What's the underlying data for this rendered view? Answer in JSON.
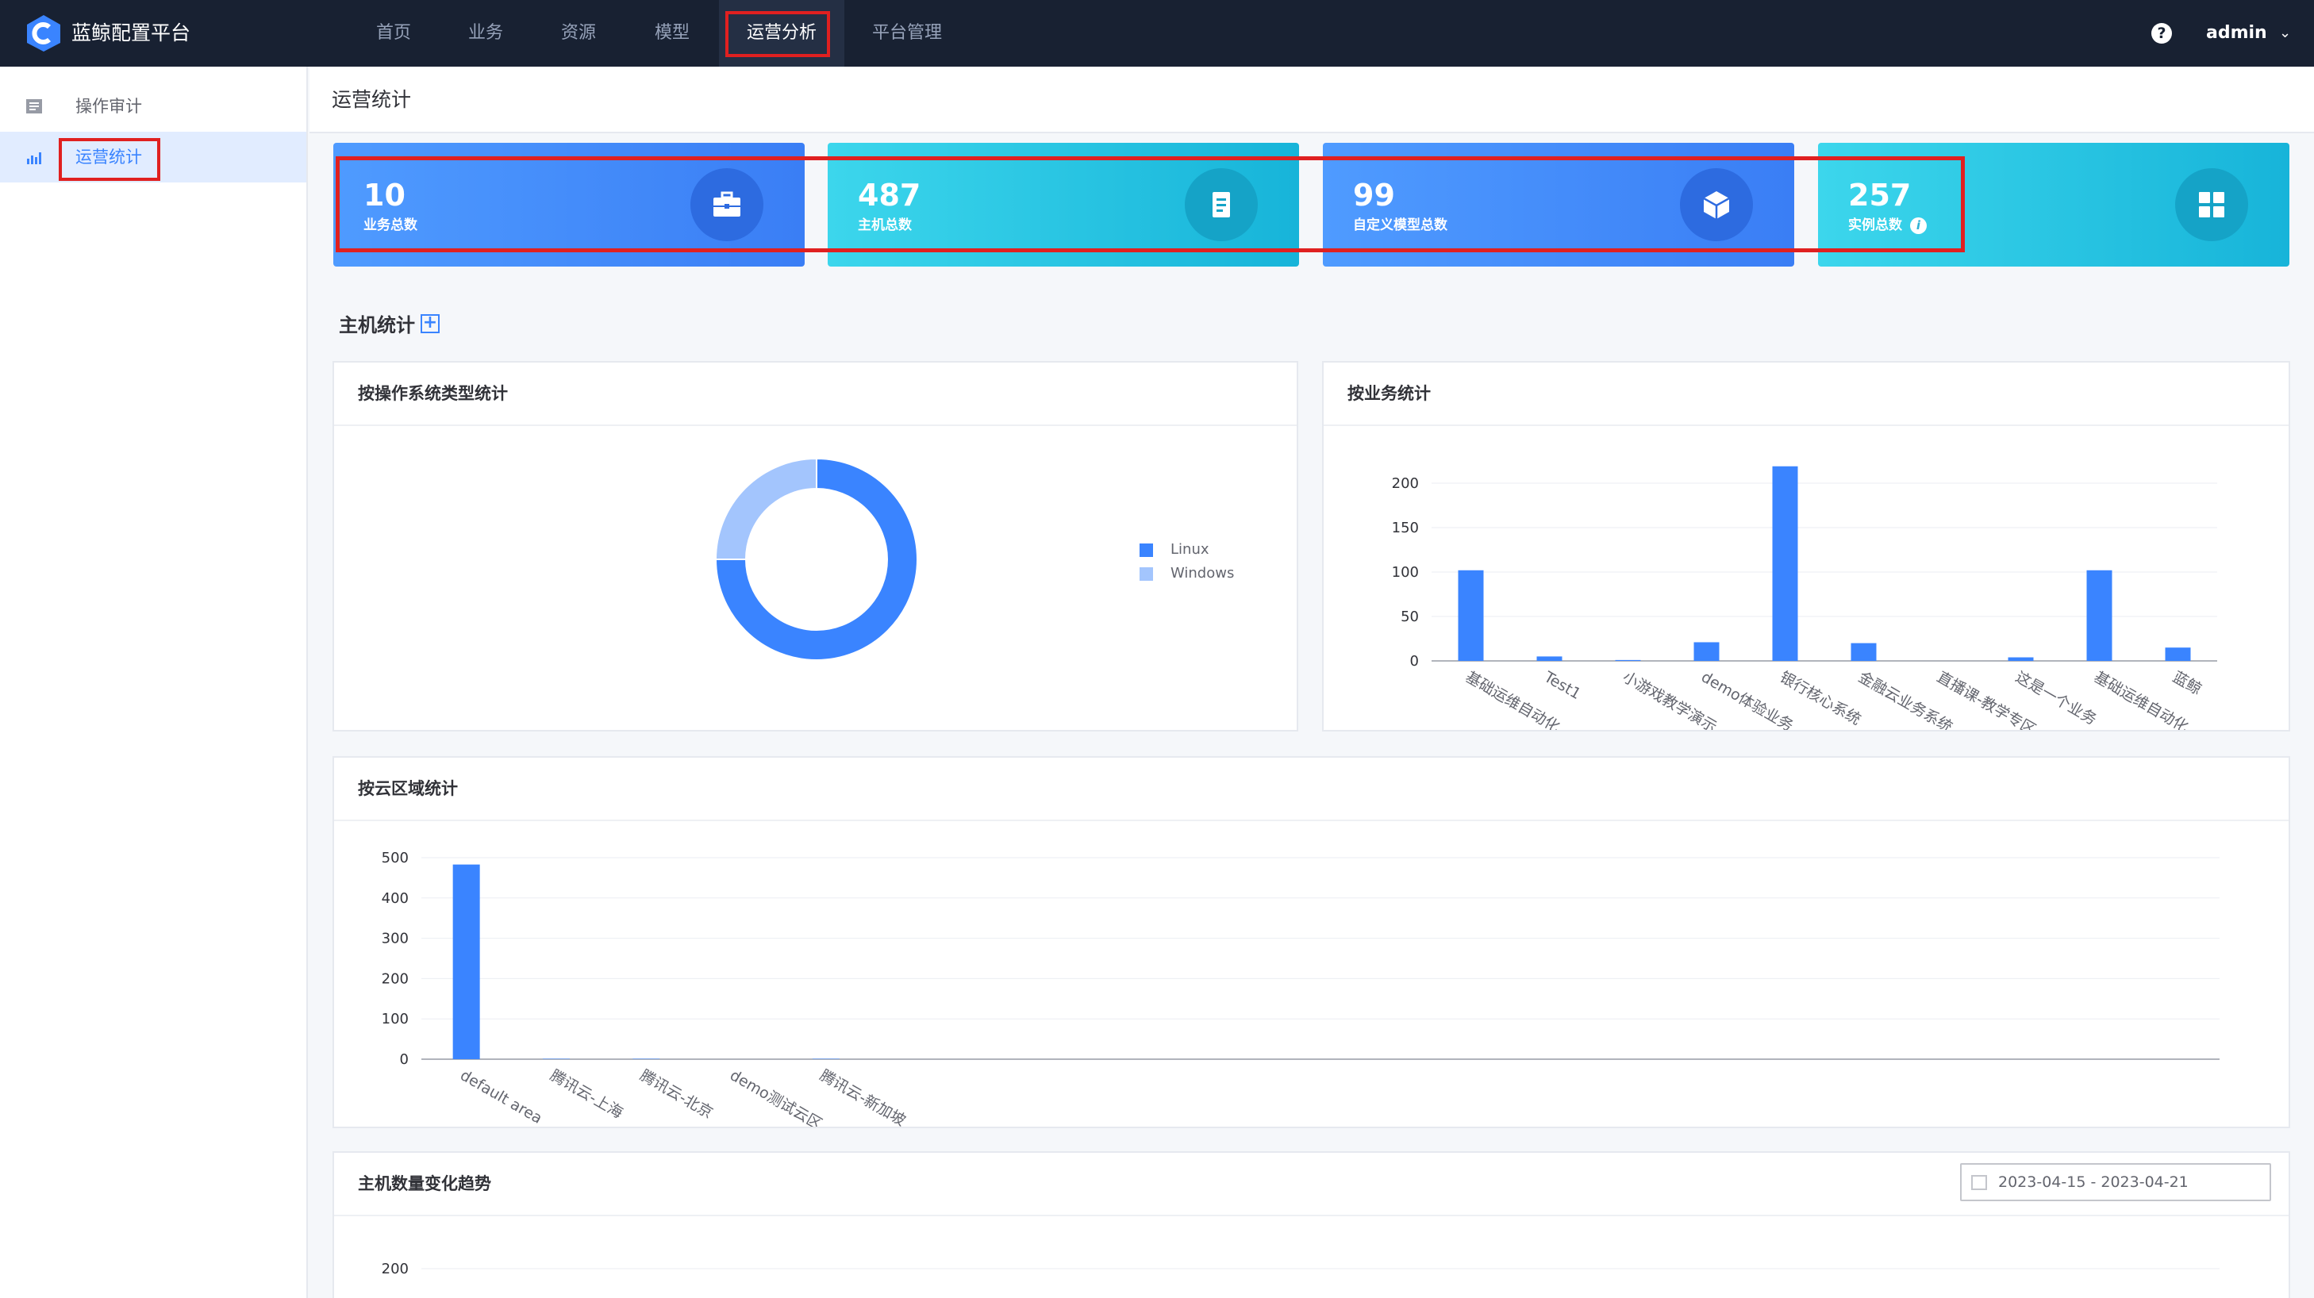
{
  "app": {
    "title": "蓝鲸配置平台"
  },
  "nav": {
    "items": [
      {
        "label": "首页"
      },
      {
        "label": "业务"
      },
      {
        "label": "资源"
      },
      {
        "label": "模型"
      },
      {
        "label": "运营分析"
      },
      {
        "label": "平台管理"
      }
    ],
    "active": "运营分析",
    "help_icon": "?",
    "user": "admin"
  },
  "sidebar": {
    "items": [
      {
        "label": "操作审计",
        "icon": "audit-list-icon"
      },
      {
        "label": "运营统计",
        "icon": "bar-chart-icon"
      }
    ],
    "active": "运营统计"
  },
  "page": {
    "title": "运营统计"
  },
  "stats": [
    {
      "value": "10",
      "label": "业务总数",
      "icon": "briefcase-icon",
      "color": "#3a7ef5"
    },
    {
      "value": "487",
      "label": "主机总数",
      "icon": "document-icon",
      "color": "#17b4d9"
    },
    {
      "value": "99",
      "label": "自定义模型总数",
      "icon": "cube-icon",
      "color": "#3a7ef5"
    },
    {
      "value": "257",
      "label": "实例总数",
      "icon": "grid-icon",
      "color": "#17b4d9",
      "info_icon": "i"
    }
  ],
  "host_section": {
    "title": "主机统计",
    "expand_icon": "+"
  },
  "os_panel": {
    "title": "按操作系统类型统计"
  },
  "biz_panel": {
    "title": "按业务统计"
  },
  "cloud_panel": {
    "title": "按云区域统计"
  },
  "trend_panel": {
    "title": "主机数量变化趋势",
    "date_range": "2023-04-15 - 2023-04-21"
  },
  "chart_data": [
    {
      "type": "pie",
      "title": "按操作系统类型统计",
      "categories": [
        "Linux",
        "Windows"
      ],
      "values": [
        75,
        25
      ],
      "colors": [
        "#3a84ff",
        "#a3c5fd"
      ],
      "legend": "right"
    },
    {
      "type": "bar",
      "title": "按业务统计",
      "categories": [
        "基础运维自动化",
        "Test1",
        "小游戏教学演示",
        "demo体验业务",
        "银行核心系统",
        "金融云业务系统",
        "直播课-教学专区",
        "这是一个业务",
        "基础运维自动化",
        "蓝鲸"
      ],
      "display_labels": [
        "基础运维自动化",
        "Test1",
        "小游戏教学演示",
        "demo体验业务",
        "银行核心系统",
        "金融云业务系统",
        "直播课-教学专区",
        "这是一个业务",
        "基础运维自动化",
        "蓝鲸"
      ],
      "values": [
        102,
        5,
        1,
        21,
        219,
        20,
        0,
        4,
        102,
        15
      ],
      "ylim": [
        0,
        200
      ],
      "yticks": [
        0,
        50,
        100,
        150,
        200
      ],
      "grid": true,
      "color": "#3a84ff"
    },
    {
      "type": "bar",
      "title": "按云区域统计",
      "categories": [
        "default area",
        "腾讯云-上海",
        "腾讯云-北京",
        "demo测试云区域",
        "腾讯云-新加坡"
      ],
      "display_labels": [
        "default area",
        "腾讯云-上海",
        "腾讯云-北京",
        "demo测试云区",
        "腾讯云-新加坡"
      ],
      "values": [
        483,
        1,
        1,
        0,
        1
      ],
      "ylim": [
        0,
        500
      ],
      "yticks": [
        0,
        100,
        200,
        300,
        400,
        500
      ],
      "grid": true,
      "color": "#3a84ff"
    },
    {
      "type": "line",
      "title": "主机数量变化趋势",
      "yticks_visible": [
        200
      ]
    }
  ]
}
